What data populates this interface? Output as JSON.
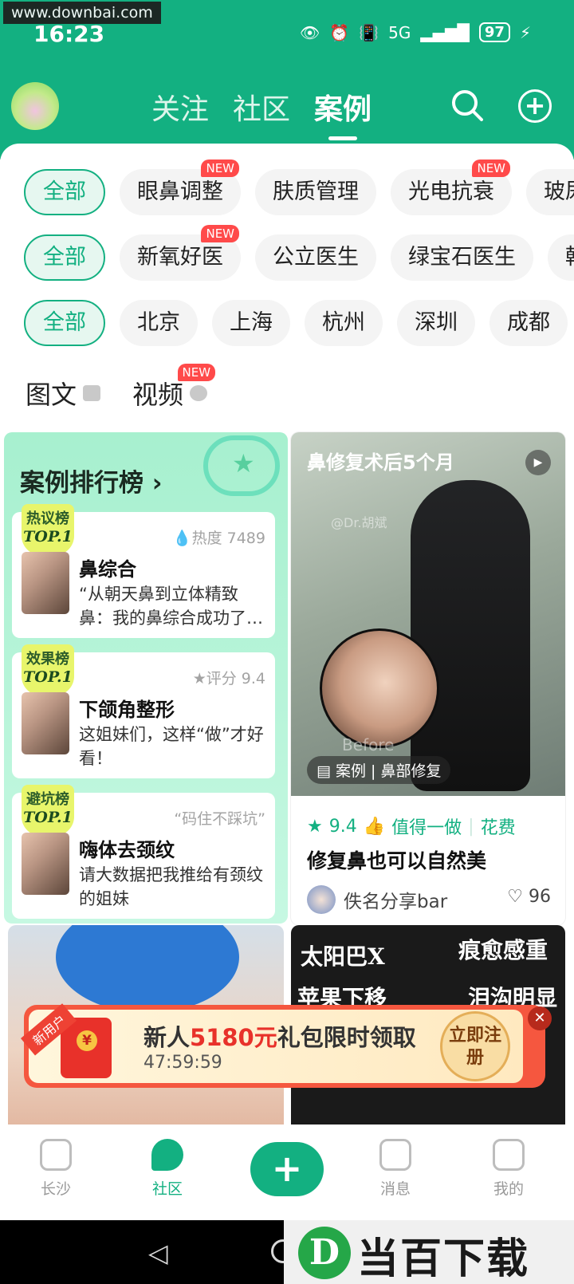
{
  "watermark_top": "www.downbai.com",
  "status": {
    "time": "16:23",
    "battery": "97",
    "network": "5G"
  },
  "nav": {
    "tabs": [
      "关注",
      "社区",
      "案例"
    ],
    "active": 2
  },
  "filters": {
    "row1": [
      {
        "label": "全部",
        "active": true,
        "new": false
      },
      {
        "label": "眼鼻调整",
        "new": true
      },
      {
        "label": "肤质管理",
        "new": false
      },
      {
        "label": "光电抗衰",
        "new": true
      },
      {
        "label": "玻尿",
        "new": false
      }
    ],
    "row2": [
      {
        "label": "全部",
        "active": true,
        "new": false
      },
      {
        "label": "新氧好医",
        "new": true
      },
      {
        "label": "公立医生",
        "new": false
      },
      {
        "label": "绿宝石医生",
        "new": false
      },
      {
        "label": "韩",
        "new": false
      }
    ],
    "row3": [
      {
        "label": "全部",
        "active": true
      },
      {
        "label": "北京"
      },
      {
        "label": "上海"
      },
      {
        "label": "杭州"
      },
      {
        "label": "深圳"
      },
      {
        "label": "成都"
      }
    ],
    "new_badge": "NEW"
  },
  "media_filter": {
    "image_text": "图文",
    "video": "视频"
  },
  "ranking": {
    "title": "案例排行榜",
    "items": [
      {
        "badge_top": "热议榜",
        "badge_bottom": "TOP.1",
        "meta": "热度 7489",
        "name": "鼻综合",
        "desc": "“从朝天鼻到立体精致鼻：我的鼻综合成功了…"
      },
      {
        "badge_top": "效果榜",
        "badge_bottom": "TOP.1",
        "meta": "评分 9.4",
        "name": "下颌角整形",
        "desc": "这姐妹们，这样“做”才好看！"
      },
      {
        "badge_top": "避坑榜",
        "badge_bottom": "TOP.1",
        "meta": "“码住不踩坑”",
        "name": "嗨体去颈纹",
        "desc": "请大数据把我推给有颈纹的姐妹"
      }
    ]
  },
  "case_card": {
    "photo_title": "鼻修复术后5个月",
    "photo_watermark": "@Dr.胡斌",
    "photo_before": "Before",
    "tag": "案例 | 鼻部修复",
    "score": "9.4",
    "worth": "值得一做",
    "cost": "花费",
    "title": "修复鼻也可以自然美",
    "author": "佚名分享bar",
    "likes": "96"
  },
  "lower_right_texts": [
    "太阳巴X",
    "痕愈感重",
    "苹果下移",
    "泪沟明显"
  ],
  "promo": {
    "ribbon": "新用户",
    "title_prefix": "新人",
    "amount": "5180元",
    "title_suffix": "礼包限时领取",
    "timer": "47:59:59",
    "button": "立即注册"
  },
  "bottom_nav": {
    "items": [
      "长沙",
      "社区",
      "消息",
      "我的"
    ],
    "active": 1
  },
  "bottom_watermark": {
    "logo": "D",
    "text": "当百下载"
  },
  "colors": {
    "brand": "#13b081",
    "promo": "#f5573f",
    "new_badge": "#ff4a4a"
  }
}
